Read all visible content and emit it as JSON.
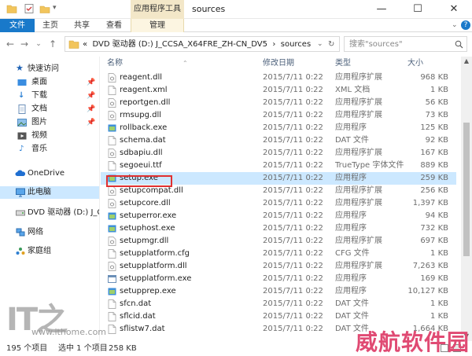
{
  "window": {
    "title": "sources",
    "context_tab_group": "应用程序工具",
    "minimize": "—",
    "maximize": "☐",
    "close": "✕"
  },
  "ribbon": {
    "tabs": [
      "文件",
      "主页",
      "共享",
      "查看",
      "管理"
    ]
  },
  "address": {
    "path_prefix": "«",
    "path": "DVD 驱动器 (D:) J_CCSA_X64FRE_ZH-CN_DV5",
    "separator": "›",
    "current": "sources",
    "search_placeholder": "搜索\"sources\""
  },
  "nav": {
    "quick_access": "快速访问",
    "desktop": "桌面",
    "downloads": "下载",
    "documents": "文档",
    "pictures": "图片",
    "videos": "视频",
    "music": "音乐",
    "onedrive": "OneDrive",
    "this_pc": "此电脑",
    "dvd": "DVD 驱动器 (D:) J_C",
    "network": "网络",
    "homegroup": "家庭组"
  },
  "columns": {
    "name": "名称",
    "date": "修改日期",
    "type": "类型",
    "size": "大小"
  },
  "files": [
    {
      "name": "reagent.dll",
      "date": "2015/7/11 0:22",
      "type": "应用程序扩展",
      "size": "968 KB",
      "icon": "dll-icon"
    },
    {
      "name": "reagent.xml",
      "date": "2015/7/11 0:22",
      "type": "XML 文档",
      "size": "1 KB",
      "icon": "file-icon"
    },
    {
      "name": "reportgen.dll",
      "date": "2015/7/11 0:22",
      "type": "应用程序扩展",
      "size": "56 KB",
      "icon": "dll-icon"
    },
    {
      "name": "rmsupg.dll",
      "date": "2015/7/11 0:22",
      "type": "应用程序扩展",
      "size": "73 KB",
      "icon": "dll-icon"
    },
    {
      "name": "rollback.exe",
      "date": "2015/7/11 0:22",
      "type": "应用程序",
      "size": "125 KB",
      "icon": "exe-icon"
    },
    {
      "name": "schema.dat",
      "date": "2015/7/11 0:22",
      "type": "DAT 文件",
      "size": "92 KB",
      "icon": "file-icon"
    },
    {
      "name": "sdbapiu.dll",
      "date": "2015/7/11 0:22",
      "type": "应用程序扩展",
      "size": "167 KB",
      "icon": "dll-icon"
    },
    {
      "name": "segoeui.ttf",
      "date": "2015/7/11 0:22",
      "type": "TrueType 字体文件",
      "size": "889 KB",
      "icon": "file-icon"
    },
    {
      "name": "setup.exe",
      "date": "2015/7/11 0:22",
      "type": "应用程序",
      "size": "259 KB",
      "icon": "exe-icon"
    },
    {
      "name": "setupcompat.dll",
      "date": "2015/7/11 0:22",
      "type": "应用程序扩展",
      "size": "256 KB",
      "icon": "dll-icon"
    },
    {
      "name": "setupcore.dll",
      "date": "2015/7/11 0:22",
      "type": "应用程序扩展",
      "size": "1,397 KB",
      "icon": "dll-icon"
    },
    {
      "name": "setuperror.exe",
      "date": "2015/7/11 0:22",
      "type": "应用程序",
      "size": "94 KB",
      "icon": "exe-icon"
    },
    {
      "name": "setuphost.exe",
      "date": "2015/7/11 0:22",
      "type": "应用程序",
      "size": "732 KB",
      "icon": "exe-icon"
    },
    {
      "name": "setupmgr.dll",
      "date": "2015/7/11 0:22",
      "type": "应用程序扩展",
      "size": "697 KB",
      "icon": "dll-icon"
    },
    {
      "name": "setupplatform.cfg",
      "date": "2015/7/11 0:22",
      "type": "CFG 文件",
      "size": "1 KB",
      "icon": "file-icon"
    },
    {
      "name": "setupplatform.dll",
      "date": "2015/7/11 0:22",
      "type": "应用程序扩展",
      "size": "7,263 KB",
      "icon": "dll-icon"
    },
    {
      "name": "setupplatform.exe",
      "date": "2015/7/11 0:22",
      "type": "应用程序",
      "size": "169 KB",
      "icon": "app-icon"
    },
    {
      "name": "setupprep.exe",
      "date": "2015/7/11 0:22",
      "type": "应用程序",
      "size": "10,127 KB",
      "icon": "exe-icon"
    },
    {
      "name": "sfcn.dat",
      "date": "2015/7/11 0:22",
      "type": "DAT 文件",
      "size": "1 KB",
      "icon": "file-icon"
    },
    {
      "name": "sflcid.dat",
      "date": "2015/7/11 0:22",
      "type": "DAT 文件",
      "size": "1 KB",
      "icon": "file-icon"
    },
    {
      "name": "sflistw7.dat",
      "date": "2015/7/11 0:22",
      "type": "DAT 文件",
      "size": "1,664 KB",
      "icon": "file-icon"
    }
  ],
  "selected_file": "setup.exe",
  "status": {
    "count": "195 个项目",
    "selected": "选中 1 个项目",
    "size": "258 KB"
  },
  "watermarks": {
    "brand": "IT之",
    "url": "www.ithome.com",
    "site": "威航软件园"
  }
}
